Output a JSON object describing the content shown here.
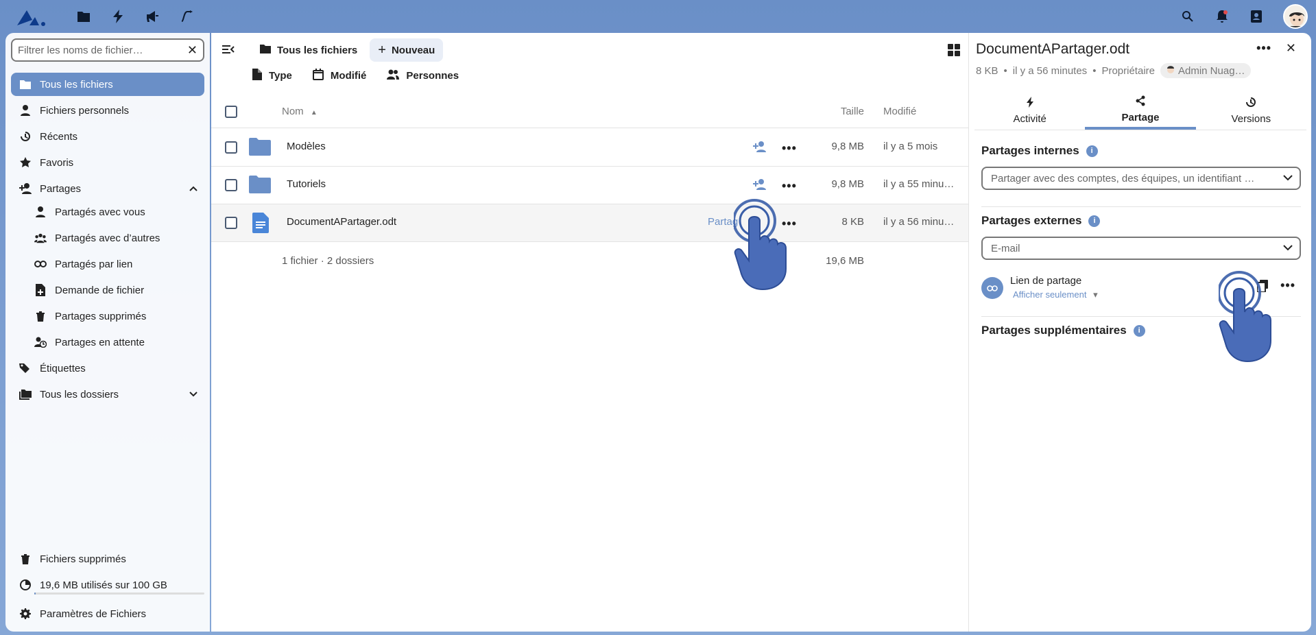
{
  "header": {
    "logo": "nextcloud-logo",
    "apps": [
      "files-icon",
      "activity-icon",
      "announcements-icon",
      "flows-icon"
    ],
    "right_icons": [
      "search-icon",
      "bell-icon",
      "contacts-icon"
    ]
  },
  "sidebar": {
    "search_placeholder": "Filtrer les noms de fichier…",
    "items": [
      {
        "label": "Tous les fichiers"
      },
      {
        "label": "Fichiers personnels"
      },
      {
        "label": "Récents"
      },
      {
        "label": "Favoris"
      },
      {
        "label": "Partages"
      },
      {
        "label": "Partagés avec vous"
      },
      {
        "label": "Partagés avec d’autres"
      },
      {
        "label": "Partagés par lien"
      },
      {
        "label": "Demande de fichier"
      },
      {
        "label": "Partages supprimés"
      },
      {
        "label": "Partages en attente"
      },
      {
        "label": "Étiquettes"
      },
      {
        "label": "Tous les dossiers"
      }
    ],
    "bottom": {
      "trash": "Fichiers supprimés",
      "quota": "19,6 MB utilisés sur 100 GB",
      "quota_fraction": 0.0002,
      "settings": "Paramètres de Fichiers"
    }
  },
  "main": {
    "breadcrumb": "Tous les fichiers",
    "new_button": "Nouveau",
    "filters": {
      "type": "Type",
      "modified": "Modifié",
      "people": "Personnes"
    },
    "columns": {
      "name": "Nom",
      "size": "Taille",
      "modified": "Modifié"
    },
    "rows": [
      {
        "name": "Modèles",
        "size": "9,8 MB",
        "modified": "il y a 5 mois"
      },
      {
        "name": "Tutoriels",
        "size": "9,8 MB",
        "modified": "il y a 55 minu…"
      },
      {
        "name": "DocumentAPartager.odt",
        "size": "8 KB",
        "modified": "il y a 56 minu…",
        "share_label": "Partag"
      }
    ],
    "summary": {
      "text": "1 fichier · 2 dossiers",
      "total": "19,6 MB"
    }
  },
  "panel": {
    "title": "DocumentAPartager.odt",
    "meta_size": "8 KB",
    "meta_time": "il y a 56 minutes",
    "meta_owner_label": "Propriétaire",
    "meta_owner": "Admin Nuag…",
    "tabs": {
      "activity": "Activité",
      "sharing": "Partage",
      "versions": "Versions"
    },
    "internal": {
      "title": "Partages internes",
      "placeholder": "Partager avec des comptes, des équipes, un identifiant …"
    },
    "external": {
      "title": "Partages externes",
      "placeholder": "E-mail"
    },
    "share_link": {
      "title": "Lien de partage",
      "permission": "Afficher seulement"
    },
    "additional": {
      "title": "Partages supplémentaires"
    }
  }
}
